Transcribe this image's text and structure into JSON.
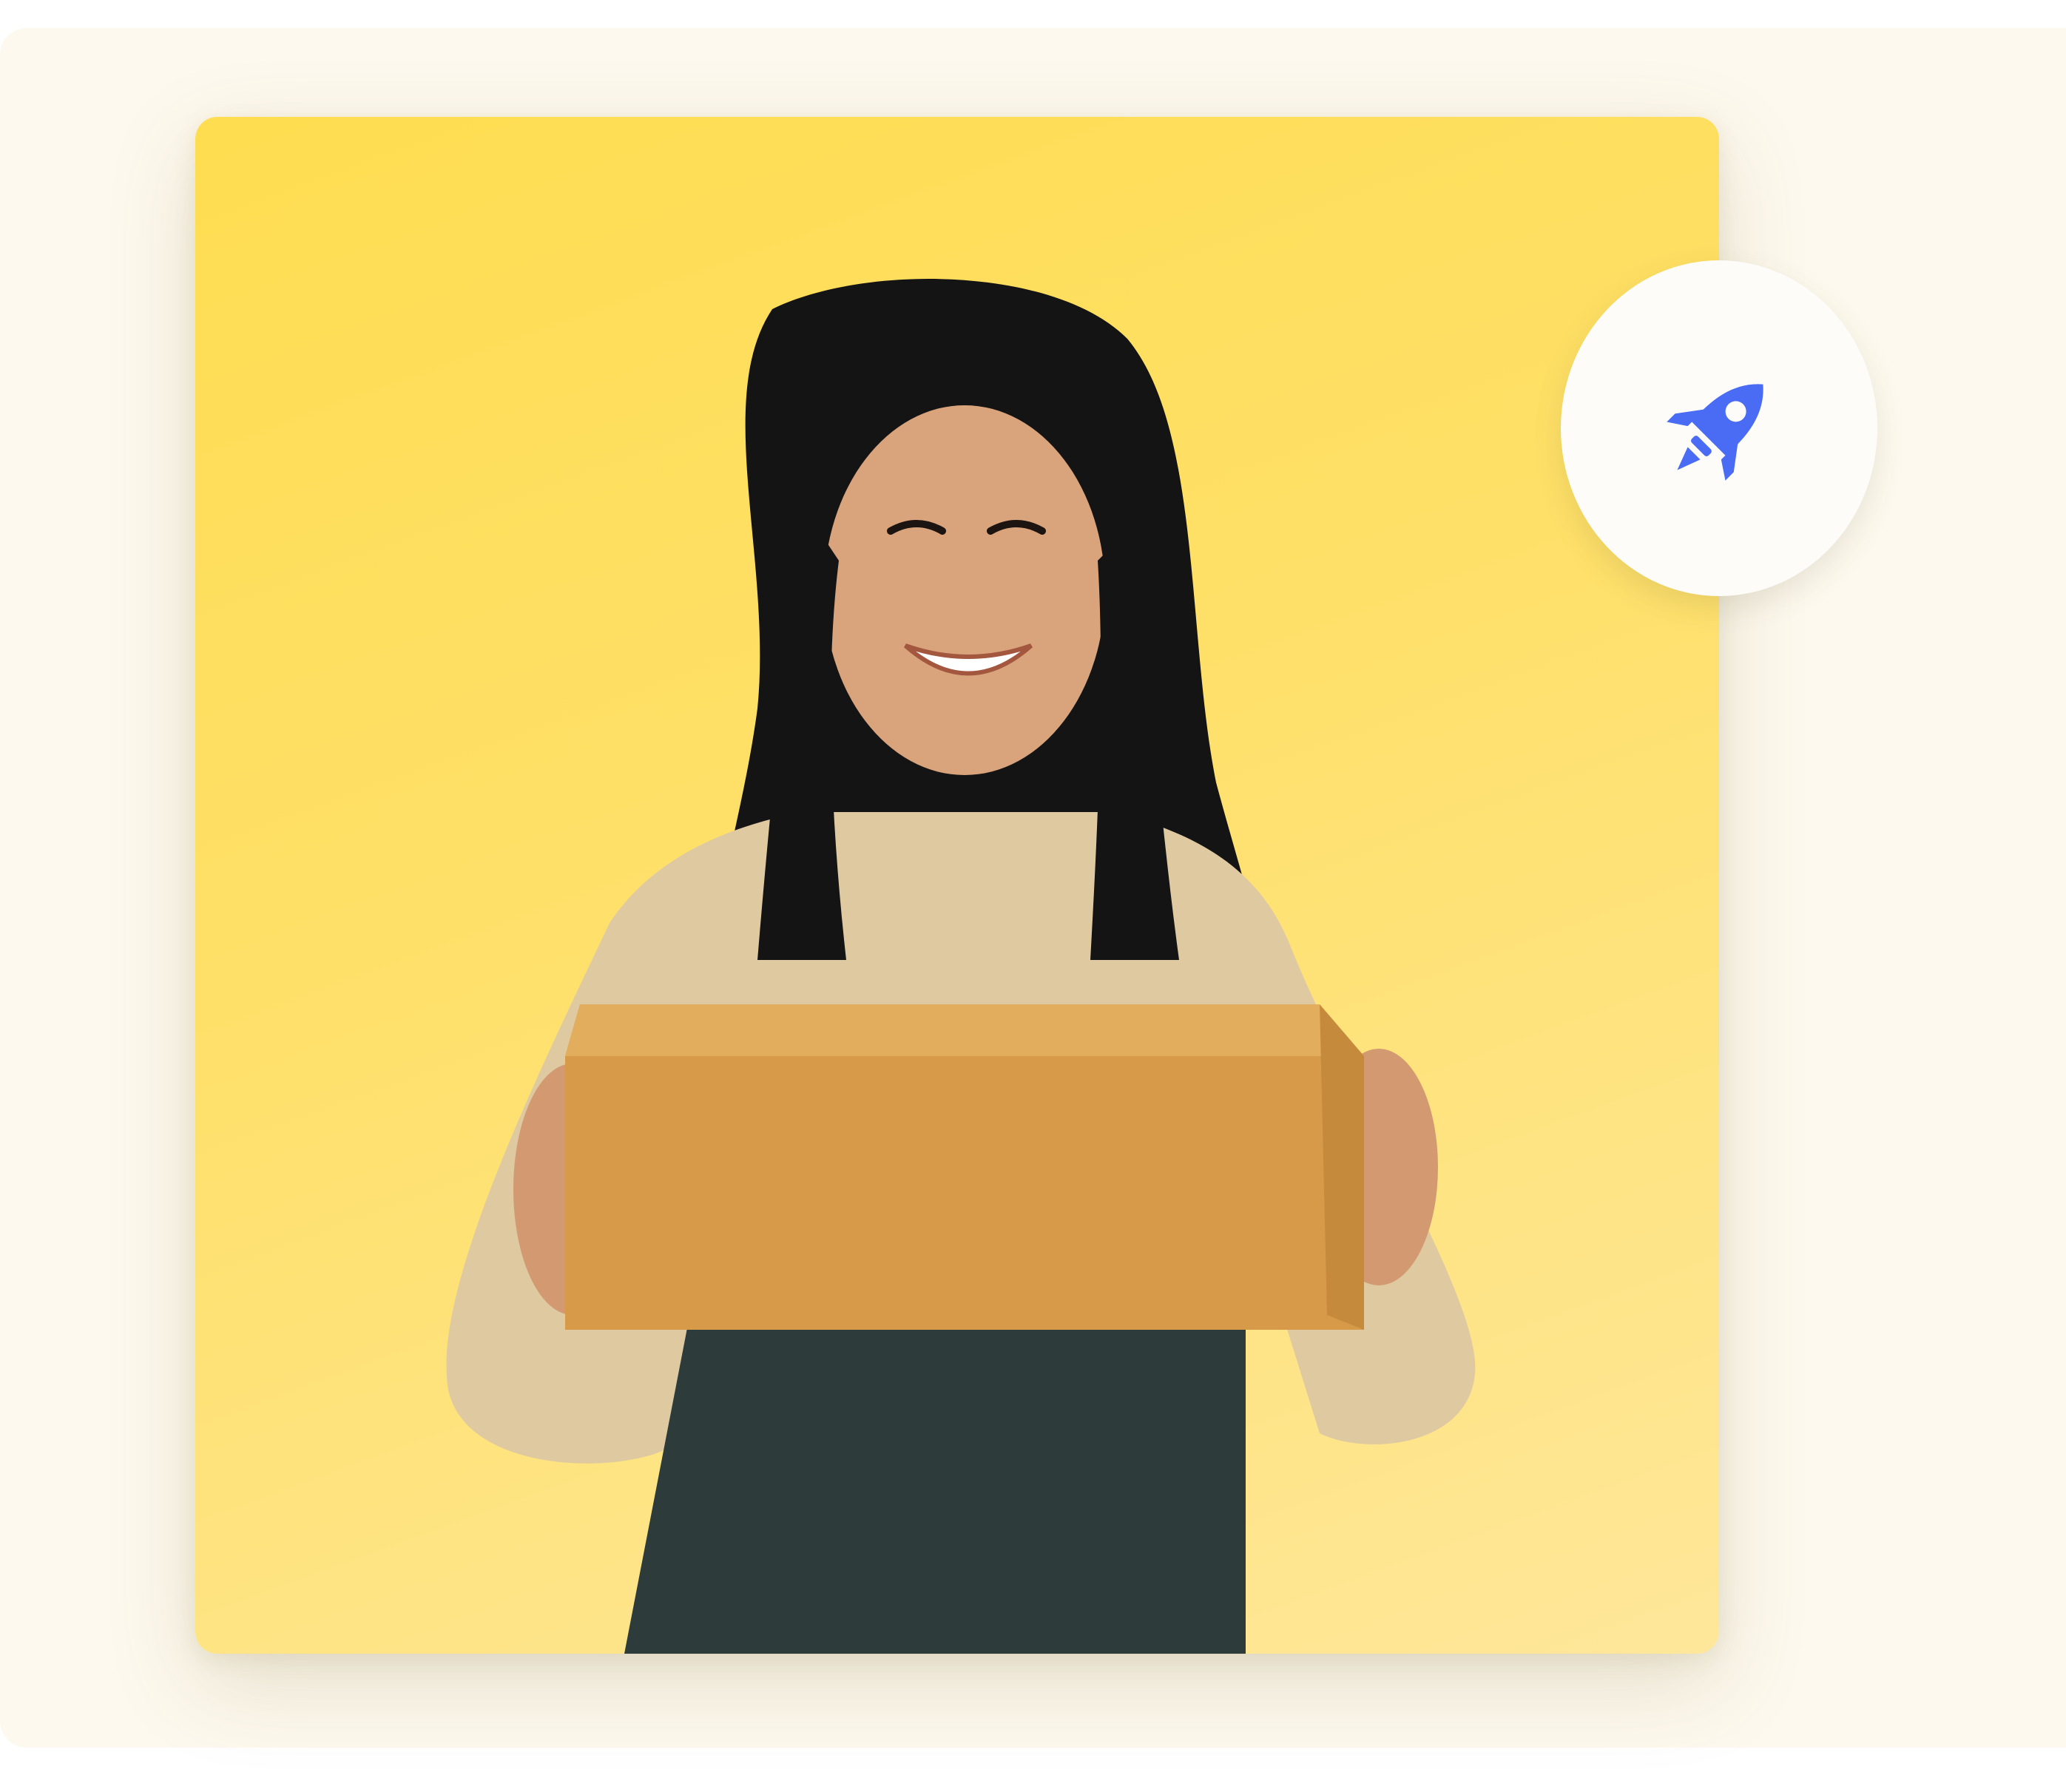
{
  "card": {
    "accent_background": "#fedd50"
  },
  "badge": {
    "icon": "rocket-icon",
    "icon_color": "#4a6cf5",
    "background": "#fdfcf8"
  },
  "photo": {
    "subject": "person-holding-box"
  }
}
